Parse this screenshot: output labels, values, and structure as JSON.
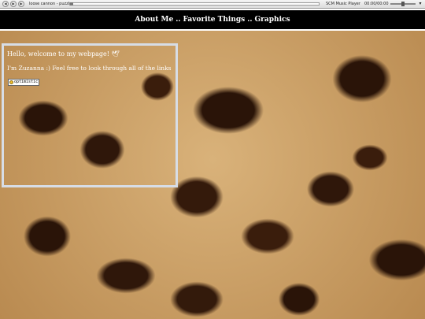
{
  "player": {
    "track": "loose cannon - puzzle",
    "name": "SCM Music Player",
    "time": "00:00/00:00"
  },
  "nav": {
    "items": [
      {
        "label": "About Me"
      },
      {
        "label": "Favorite Things"
      },
      {
        "label": "Graphics"
      }
    ],
    "separator": ".."
  },
  "welcome": {
    "greeting": "Hello, welcome to my webpage!",
    "intro": "I'm Zuzanna :) Feel free to look through all of the links",
    "mood_text": "optimistic"
  },
  "colors": {
    "nav_bg": "#000000",
    "box_border": "#d7dde6"
  }
}
